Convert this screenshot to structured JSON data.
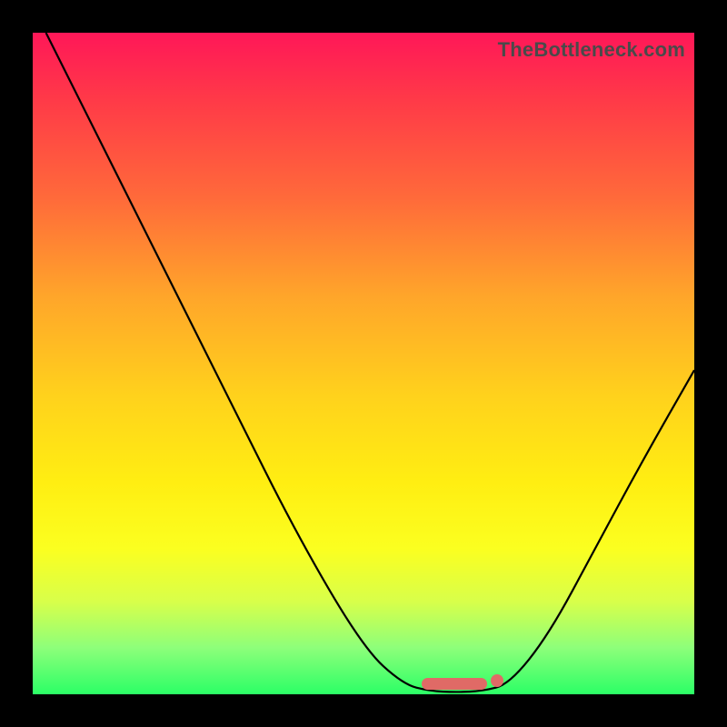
{
  "watermark": "TheBottleneck.com",
  "colors": {
    "frame_bg": "#000000",
    "gradient_top": "#ff1758",
    "gradient_bottom": "#2bff66",
    "curve": "#000000",
    "marker": "#e06a66"
  },
  "chart_data": {
    "type": "line",
    "title": "",
    "xlabel": "",
    "ylabel": "",
    "xlim": [
      0,
      100
    ],
    "ylim": [
      0,
      100
    ],
    "grid": false,
    "curve_points_xy": [
      [
        2,
        100
      ],
      [
        10,
        84
      ],
      [
        20,
        64
      ],
      [
        30,
        44
      ],
      [
        40,
        24
      ],
      [
        50,
        7
      ],
      [
        56,
        1.5
      ],
      [
        60,
        0.5
      ],
      [
        64,
        0.3
      ],
      [
        68,
        0.5
      ],
      [
        72,
        1.5
      ],
      [
        78,
        9
      ],
      [
        85,
        22
      ],
      [
        92,
        35
      ],
      [
        100,
        49
      ]
    ],
    "minimum_marker": {
      "x_range": [
        59,
        72
      ],
      "y": 1,
      "note": "flat low region with small end dot"
    }
  }
}
